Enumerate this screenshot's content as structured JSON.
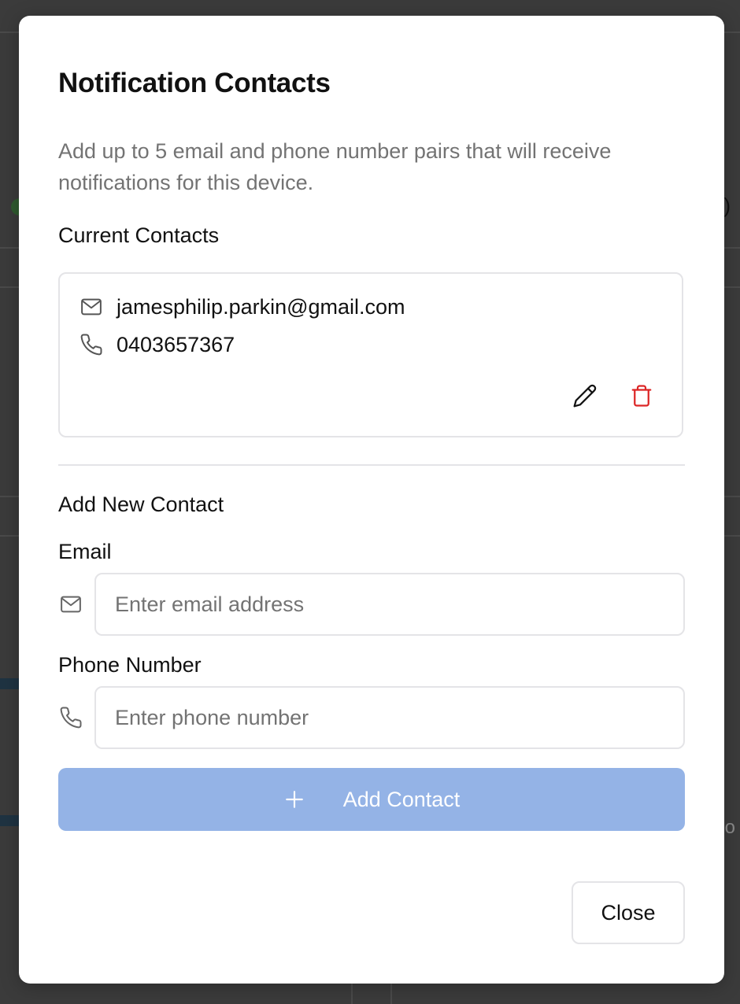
{
  "modal": {
    "title": "Notification Contacts",
    "description": "Add up to 5 email and phone number pairs that will receive notifications for this device."
  },
  "current_contacts": {
    "heading": "Current Contacts",
    "items": [
      {
        "email": "jamesphilip.parkin@gmail.com",
        "phone": "0403657367"
      }
    ],
    "icons": {
      "email": "mail-icon",
      "phone": "phone-icon",
      "edit": "pencil-icon",
      "delete": "trash-icon"
    }
  },
  "add_contact": {
    "heading": "Add New Contact",
    "email_label": "Email",
    "email_placeholder": "Enter email address",
    "email_value": "",
    "phone_label": "Phone Number",
    "phone_placeholder": "Enter phone number",
    "phone_value": "",
    "button_label": "Add Contact",
    "button_icon": "plus-icon"
  },
  "footer": {
    "close_label": "Close"
  },
  "colors": {
    "primary_disabled": "#94b3e6",
    "danger": "#dc2626",
    "border": "#e4e4e7",
    "muted_text": "#737373"
  }
}
